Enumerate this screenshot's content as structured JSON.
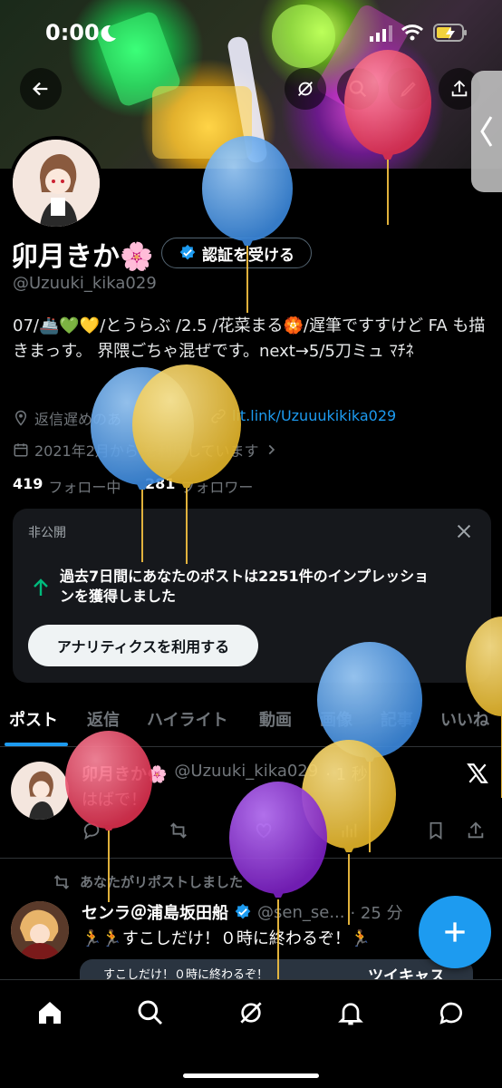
{
  "status_bar": {
    "time": "0:00"
  },
  "profile": {
    "display_name": "卯月きか🌸",
    "verify_button": "認証を受ける",
    "handle": "@Uzuuki_kika029",
    "bio": "07/🚢💚💛/とうらぶ /2.5 /花菜まる🏵️/遅筆ですすけど FA も描きまっす。 界隈ごちゃ混ぜです。next→5/5刀ミュ ﾏﾁﾈ",
    "location": "返信遅めのあ",
    "website": "lit.link/Uzuuukikika029",
    "joined": "2021年2月から  を利用しています",
    "following_count": "419",
    "following_label": "フォロー中",
    "followers_count": "281",
    "followers_label": "フォロワー"
  },
  "private_card": {
    "label": "非公開",
    "message": "過去7日間にあなたのポストは2251件のインプレッションを獲得しました",
    "message_line1": "過去7日間にあなたのポストは2251件のインプレッショ",
    "message_line2": "ンを獲得しました",
    "button": "アナリティクスを利用する"
  },
  "tabs": [
    "ポスト",
    "返信",
    "ハイライト",
    "動画",
    "画像",
    "記事",
    "いいね"
  ],
  "posts": [
    {
      "name": "卯月きか🌸",
      "handle": "@Uzuuki_kika029",
      "time": "· 1 秒",
      "text": "はばで！"
    },
    {
      "repost_note": "あなたがリポストしました",
      "name": "センラ＠浦島坂田船",
      "handle": "@sen_se...",
      "time": "· 25 分",
      "text": "🏃🏃すこしだけ！０時に終わるぞ！🏃",
      "card_text": "すこしだけ！０時に終わるぞ！",
      "card_badge": "ツイキャス"
    }
  ],
  "colors": {
    "accent": "#1d9bf0",
    "background": "#000000",
    "muted": "#71767b",
    "card": "#16181c"
  },
  "icons": [
    "back-arrow-icon",
    "grok-icon",
    "search-icon",
    "edit-icon",
    "share-icon",
    "verified-badge-icon",
    "location-icon",
    "link-icon",
    "calendar-icon",
    "close-icon",
    "arrow-up-icon",
    "x-logo-icon",
    "reply-icon",
    "repost-icon",
    "like-icon",
    "views-icon",
    "bookmark-icon",
    "home-icon",
    "notifications-icon",
    "messages-icon",
    "compose-plus-icon"
  ]
}
